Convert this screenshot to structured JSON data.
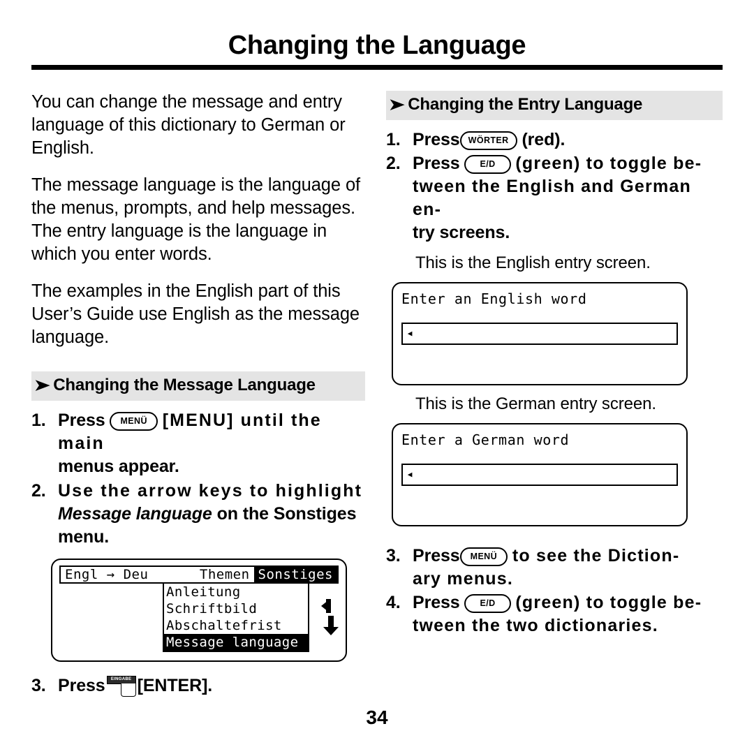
{
  "document": {
    "title": "Changing the Language",
    "page_number": "34"
  },
  "left_column": {
    "paragraphs": [
      "You can change the message and entry language of this dictionary to German or English.",
      "The message language is the language of the menus, prompts, and help messages. The entry language is the language in which you enter words.",
      "The examples in the English part of this User’s Guide use English as the message language."
    ],
    "section_heading": "Changing the Message Language",
    "section_heading_arrow": "➤",
    "steps": [
      {
        "num": "1.",
        "pre": "Press",
        "key": "MENÜ",
        "post_a": "[MENU] until the main",
        "post_b": "menus appear."
      },
      {
        "num": "2.",
        "pre": "Use the arrow keys to highlight",
        "italic": "Message language",
        "post_a": "on the Sonstiges",
        "post_b": "menu."
      },
      {
        "num": "3.",
        "pre": "Press",
        "key": "EINGABE",
        "post_a": "[ENTER]."
      }
    ],
    "lcd_menu": {
      "menubar": [
        {
          "label": "Engl → Deu",
          "selected": false
        },
        {
          "label": "Themen",
          "selected": false
        },
        {
          "label": "Sonstiges",
          "selected": true
        }
      ],
      "dropdown": [
        {
          "label": "Anleitung",
          "selected": false
        },
        {
          "label": "Schriftbild",
          "selected": false
        },
        {
          "label": "Abschaltefrist",
          "selected": false
        },
        {
          "label": "Message language",
          "selected": true
        }
      ],
      "scroll_arrows": "up-down-arrows-icon"
    }
  },
  "right_column": {
    "section_heading": "Changing the Entry Language",
    "section_heading_arrow": "➤",
    "steps": [
      {
        "num": "1.",
        "pre": "Press",
        "key": "WÖRTER",
        "post_a": "(red)."
      },
      {
        "num": "2.",
        "pre": "Press",
        "key": "E/D",
        "post_a": "(green) to toggle be-",
        "post_b": "tween the English and German en-",
        "post_c": "try screens."
      },
      {
        "num": "3.",
        "pre": "Press",
        "key": "MENÜ",
        "post_a": "to see the Diction-",
        "post_b": "ary menus."
      },
      {
        "num": "4.",
        "pre": "Press",
        "key": "E/D",
        "post_a": "(green) to toggle be-",
        "post_b": "tween the two dictionaries."
      }
    ],
    "english_caption": "This is the English entry screen.",
    "english_screen": {
      "prompt": "Enter an English word",
      "input_value": "",
      "caret": "◂"
    },
    "german_caption": "This is the German entry screen.",
    "german_screen": {
      "prompt": "Enter a German word",
      "input_value": "",
      "caret": "◂"
    }
  },
  "colors": {
    "section_heading_background": "#e4e4e4",
    "ink": "#000000",
    "paper": "#ffffff"
  }
}
